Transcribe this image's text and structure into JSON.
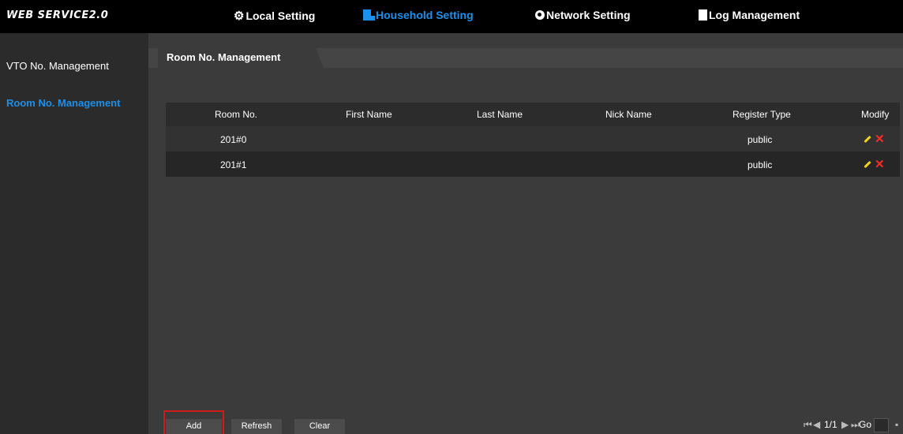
{
  "header": {
    "brand": "WEB SERVICE2.0",
    "tabs": [
      {
        "label": "Local Setting",
        "icon": "gear-icon"
      },
      {
        "label": "Household Setting",
        "icon": "building-icon",
        "active": true
      },
      {
        "label": "Network Setting",
        "icon": "globe-icon"
      },
      {
        "label": "Log Management",
        "icon": "document-icon"
      }
    ],
    "accent": "#1e8fe8"
  },
  "sidebar": {
    "items": [
      {
        "label": "VTO No. Management"
      },
      {
        "label": "Room No. Management",
        "active": true
      }
    ]
  },
  "main": {
    "tab_label": "Room No. Management",
    "columns": [
      "Room No.",
      "First Name",
      "Last Name",
      "Nick Name",
      "Register Type",
      "Modify"
    ],
    "rows": [
      {
        "room": "201#0",
        "first": "",
        "last": "",
        "nick": "",
        "type": "public"
      },
      {
        "room": "201#1",
        "first": "",
        "last": "",
        "nick": "",
        "type": "public"
      }
    ],
    "buttons": {
      "add": "Add",
      "refresh": "Refresh",
      "clear": "Clear"
    },
    "pager": {
      "page": "1/1",
      "goto_label": "Go to"
    }
  }
}
